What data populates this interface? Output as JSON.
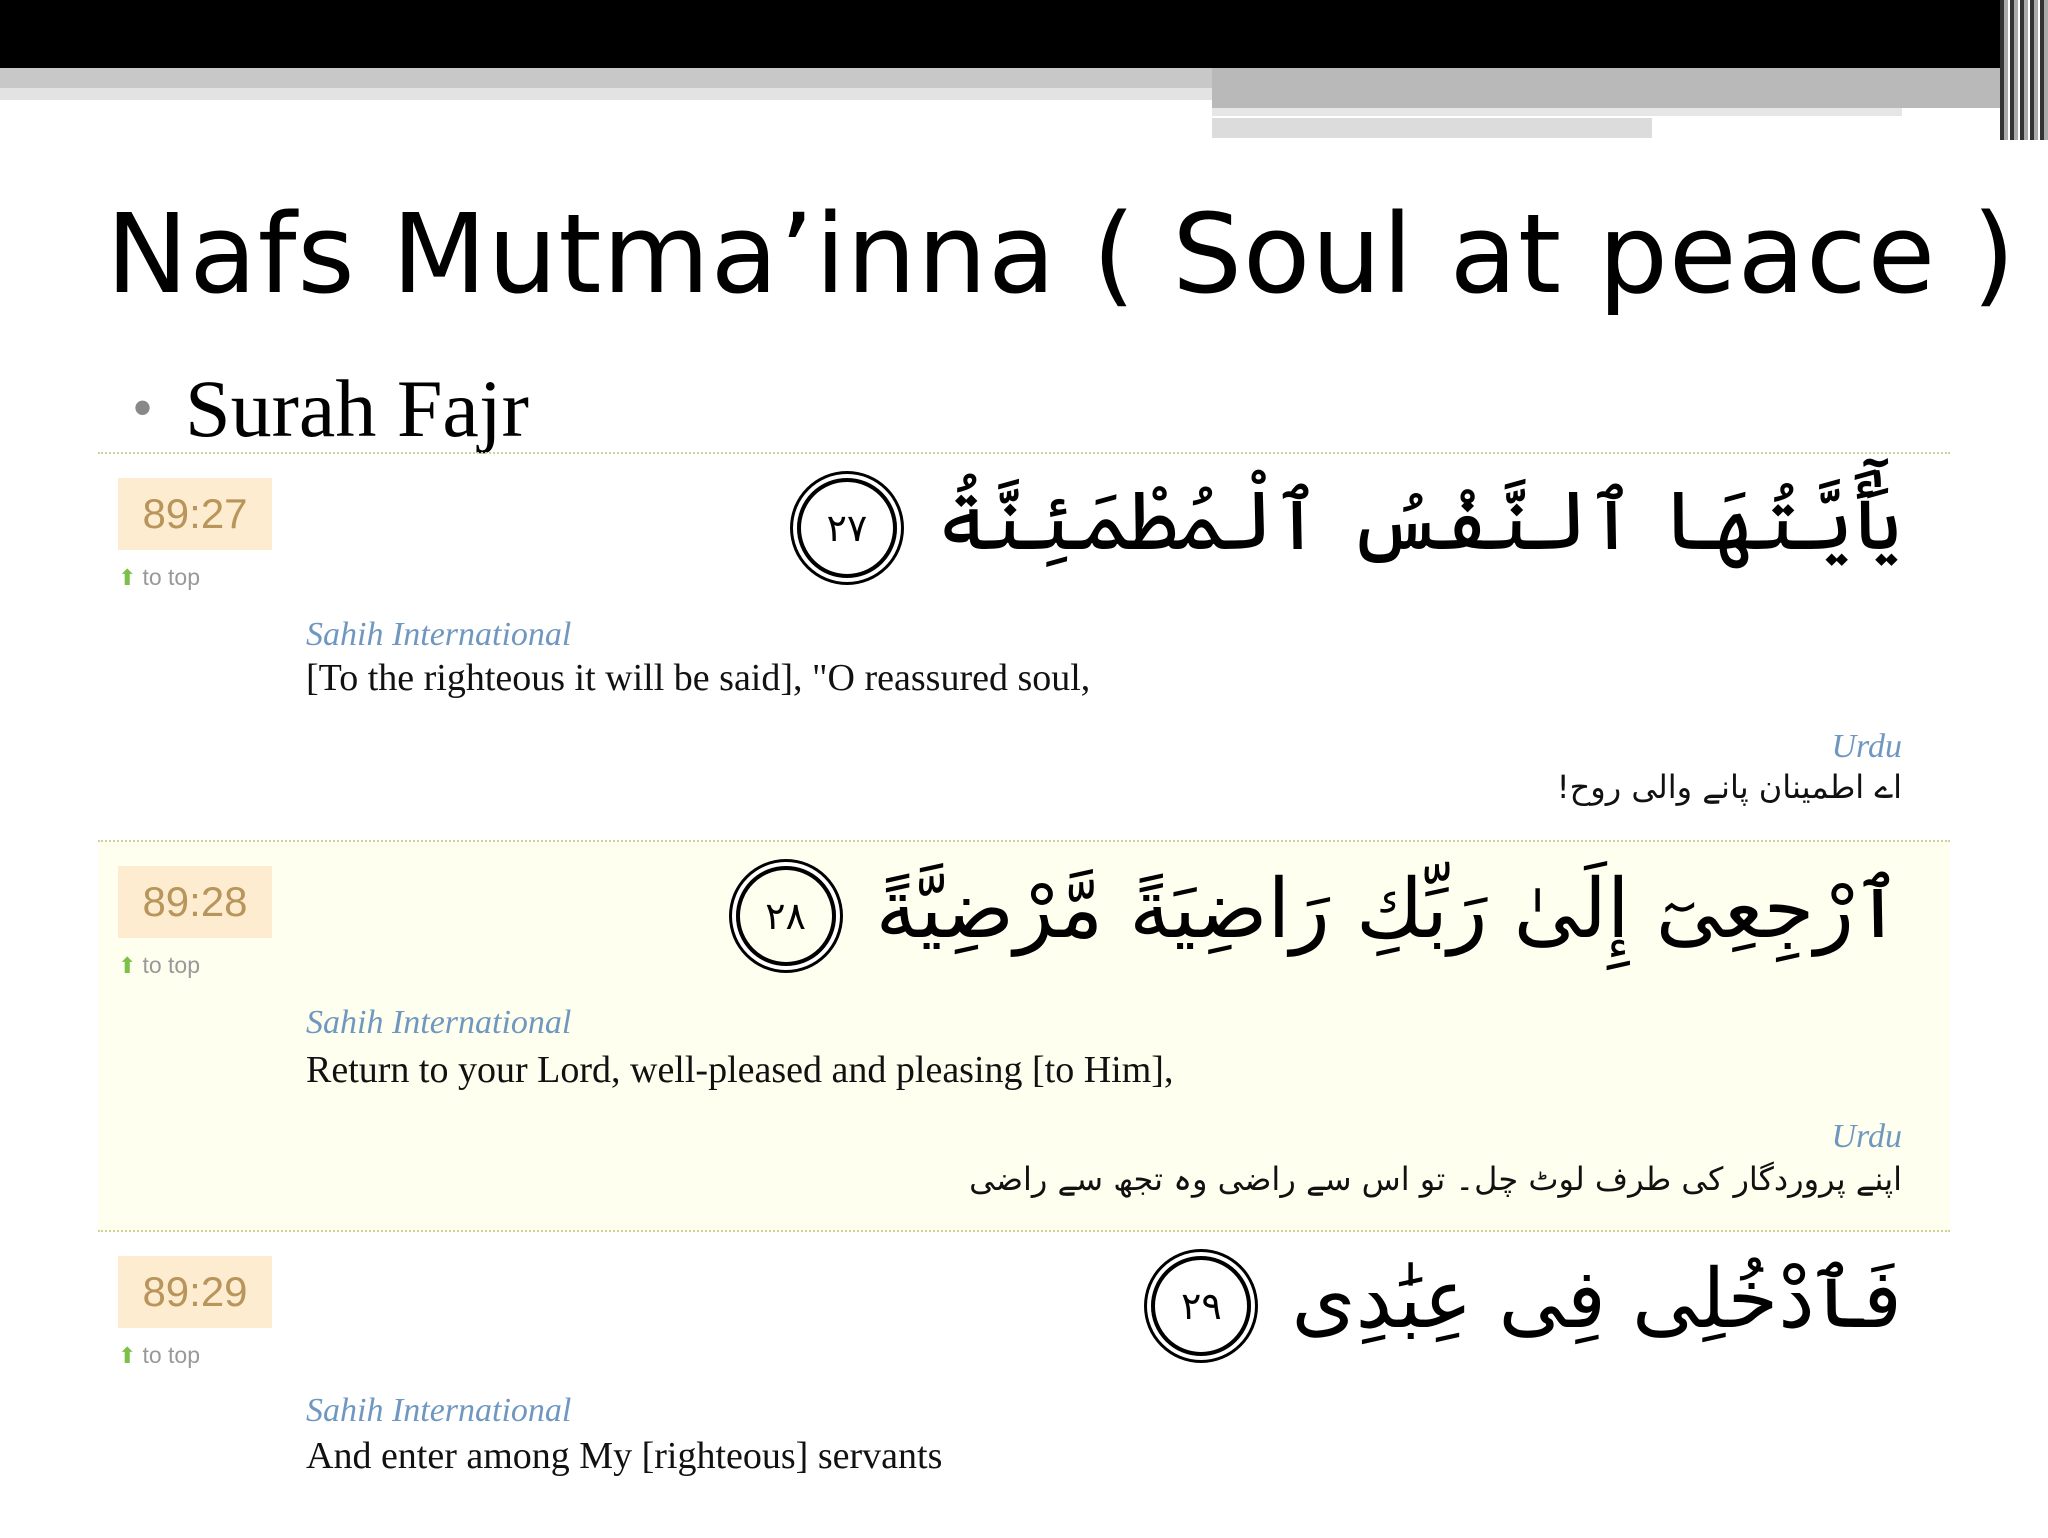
{
  "slide": {
    "title": "Nafs Mutma’inna ( Soul at peace )",
    "bullet": "Surah Fajr"
  },
  "verses": [
    {
      "ref": "89:27",
      "to_top": "to top",
      "arabic": "يَٰٓأَيَّتُهَا ٱلنَّفْسُ ٱلْمُطْمَئِنَّةُ",
      "ayah_number": "٢٧",
      "translation_label": "Sahih International",
      "translation": "[To the righteous it will be said], \"O reassured soul,",
      "urdu_label": "Urdu",
      "urdu": "اے اطمینان پانے والی روح!"
    },
    {
      "ref": "89:28",
      "to_top": "to top",
      "arabic": "ٱرْجِعِىٓ إِلَىٰ رَبِّكِ رَاضِيَةً مَّرْضِيَّةً",
      "ayah_number": "٢٨",
      "translation_label": "Sahih International",
      "translation": "Return to your Lord, well-pleased and pleasing [to Him],",
      "urdu_label": "Urdu",
      "urdu": "اپنے پروردگار کی طرف لوٹ چل۔ تو اس سے راضی وہ تجھ سے راضی"
    },
    {
      "ref": "89:29",
      "to_top": "to top",
      "arabic": "فَٱدْخُلِى فِى عِبَٰدِى",
      "ayah_number": "٢٩",
      "translation_label": "Sahih International",
      "translation": "And enter among My [righteous] servants"
    }
  ],
  "colors": {
    "highlight_bg": "#fffff0",
    "ref_bg": "#fdecd0",
    "ref_text": "#b8955a",
    "label_blue": "#6f97c0",
    "arrow_green": "#7cc04a"
  }
}
